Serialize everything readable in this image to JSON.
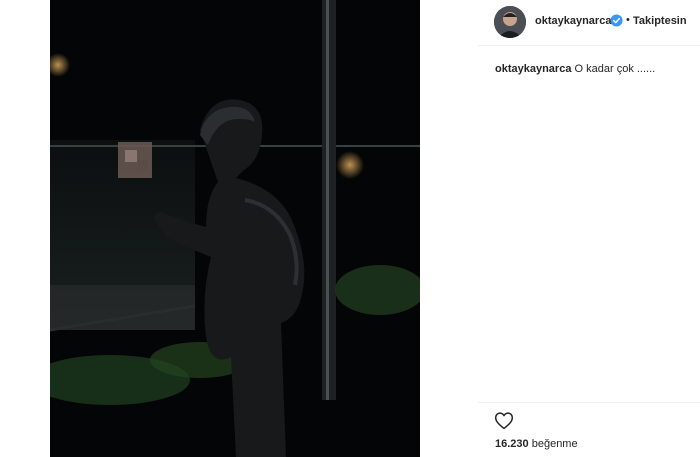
{
  "post": {
    "username": "oktaykaynarca",
    "follow_label": "Takiptesin",
    "separator": "•",
    "caption_user": "oktaykaynarca",
    "caption_text": "O kadar çok ......",
    "likes_count": "16.230",
    "likes_label": "beğenme"
  },
  "icons": {
    "verified": "verified-badge-icon",
    "like": "heart-outline-icon"
  },
  "colors": {
    "verified_blue": "#3897f0",
    "text": "#262626",
    "divider": "#efefef",
    "photo_bg": "#050607"
  }
}
